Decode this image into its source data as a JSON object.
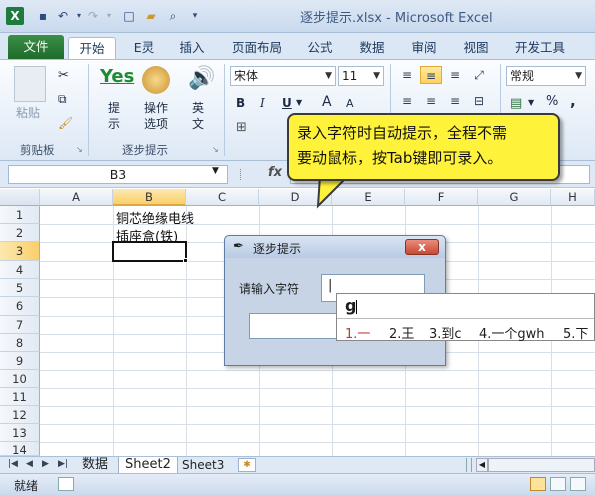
{
  "window": {
    "title": "逐步提示.xlsx - Microsoft Excel",
    "logo": "X"
  },
  "quick_access": {
    "icons": [
      "save-icon",
      "undo-icon",
      "redo-icon",
      "new-icon",
      "open-icon",
      "print-preview-icon",
      "customize-icon"
    ]
  },
  "ribbon": {
    "tabs": [
      "文件",
      "开始",
      "E灵",
      "插入",
      "页面布局",
      "公式",
      "数据",
      "审阅",
      "视图",
      "开发工具"
    ],
    "active_tab": "开始",
    "clipboard": {
      "paste": "粘贴",
      "label": "剪贴板"
    },
    "step_prompt_group": {
      "yes_label": "Yes",
      "btn1": "提\n示",
      "btn2": "操作\n选项",
      "btn3": "英\n文",
      "label": "逐步提示"
    },
    "font": {
      "name": "宋体",
      "size": "11",
      "bold": "B",
      "italic": "I",
      "underline": "U",
      "grow": "A",
      "shrink": "A"
    },
    "number": {
      "format": "常规",
      "percent": "%",
      "comma": ","
    }
  },
  "formula_bar": {
    "name_box": "B3",
    "fx": "fx",
    "value": ""
  },
  "grid": {
    "columns": [
      "A",
      "B",
      "C",
      "D",
      "E",
      "F",
      "G",
      "H"
    ],
    "selected_column": "B",
    "rows": [
      "1",
      "2",
      "3",
      "4",
      "5",
      "6",
      "7",
      "8",
      "9",
      "10",
      "11",
      "12",
      "13",
      "14"
    ],
    "selected_row": "3",
    "cells": {
      "B1": "铜芯绝缘电线",
      "B2": "插座盒(铁)"
    }
  },
  "sheets": {
    "tabs": [
      "数据",
      "Sheet2",
      "Sheet3"
    ],
    "active": "Sheet2"
  },
  "status": {
    "ready": "就绪"
  },
  "dialog": {
    "title": "逐步提示",
    "close": "x",
    "prompt_label": "请输入字符",
    "input_value": "|"
  },
  "ime": {
    "typed": "g",
    "candidates": [
      "1.一",
      "2.王",
      "3.到c",
      "4.一个gwh",
      "5.下"
    ]
  },
  "callout": {
    "text_line1": "录入字符时自动提示，全程不需",
    "text_line2": "要动鼠标，按Tab键即可录入。"
  },
  "colors": {
    "file_tab": "#1f6b2b",
    "callout": "#fff23a",
    "ime_highlight": "#c0392b"
  }
}
